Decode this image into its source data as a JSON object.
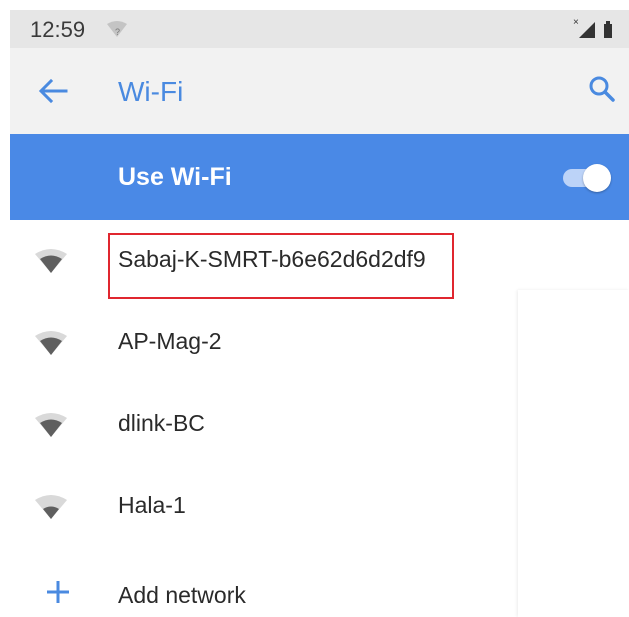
{
  "status_bar": {
    "time": "12:59"
  },
  "header": {
    "title": "Wi-Fi"
  },
  "master_switch": {
    "label": "Use Wi-Fi",
    "enabled": true
  },
  "networks": [
    {
      "name": "Sabaj-K-SMRT-b6e62d6d2df9",
      "highlighted": true
    },
    {
      "name": "AP-Mag-2"
    },
    {
      "name": "dlink-BC"
    },
    {
      "name": "Hala-1"
    }
  ],
  "add_network": {
    "label": "Add network",
    "icon": "plus-icon"
  },
  "colors": {
    "accent": "#4a89e6",
    "title": "#4a8ae0",
    "highlight": "#e0262f",
    "status_bar": "#e6e6e6",
    "app_bar": "#f2f2f2"
  }
}
